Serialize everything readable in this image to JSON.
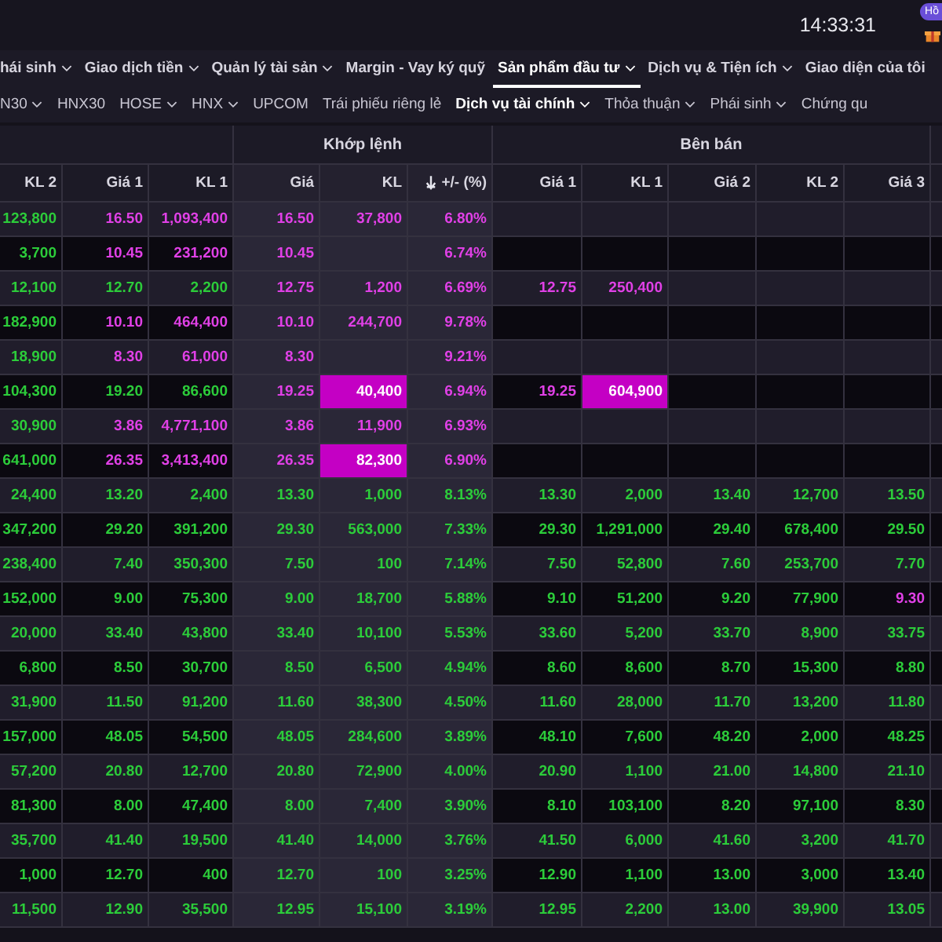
{
  "top_bar": {
    "time": "14:33:31",
    "badge": "Hồ"
  },
  "main_menu": [
    {
      "label": "hái sinh",
      "dropdown": true,
      "selected": false
    },
    {
      "label": "Giao dịch tiền",
      "dropdown": true,
      "selected": false
    },
    {
      "label": "Quản lý tài sản",
      "dropdown": true,
      "selected": false
    },
    {
      "label": "Margin - Vay ký quỹ",
      "dropdown": false,
      "selected": false
    },
    {
      "label": "Sản phẩm đầu tư",
      "dropdown": true,
      "selected": true
    },
    {
      "label": "Dịch vụ & Tiện ích",
      "dropdown": true,
      "selected": false
    },
    {
      "label": "Giao diện của tôi",
      "dropdown": false,
      "selected": false
    }
  ],
  "board_tabs": [
    {
      "label": "N30",
      "dropdown": true,
      "selected": false
    },
    {
      "label": "HNX30",
      "dropdown": false,
      "selected": false
    },
    {
      "label": "HOSE",
      "dropdown": true,
      "selected": false
    },
    {
      "label": "HNX",
      "dropdown": true,
      "selected": false
    },
    {
      "label": "UPCOM",
      "dropdown": false,
      "selected": false
    },
    {
      "label": "Trái phiếu riêng lẻ",
      "dropdown": false,
      "selected": false
    },
    {
      "label": "Dịch vụ tài chính",
      "dropdown": true,
      "selected": true
    },
    {
      "label": "Thỏa thuận",
      "dropdown": true,
      "selected": false
    },
    {
      "label": "Phái sinh",
      "dropdown": true,
      "selected": false
    },
    {
      "label": "Chứng qu",
      "dropdown": false,
      "selected": false
    }
  ],
  "table": {
    "groups": [
      "Khớp lệnh",
      "Bên bán"
    ],
    "columns": [
      {
        "label": "KL 2",
        "sorted": false
      },
      {
        "label": "Giá 1",
        "sorted": false
      },
      {
        "label": "KL 1",
        "sorted": false
      },
      {
        "label": "Giá",
        "sorted": false
      },
      {
        "label": "KL",
        "sorted": false
      },
      {
        "label": "+/- (%)",
        "sorted": true
      },
      {
        "label": "Giá 1",
        "sorted": false
      },
      {
        "label": "KL 1",
        "sorted": false
      },
      {
        "label": "Giá 2",
        "sorted": false
      },
      {
        "label": "KL 2",
        "sorted": false
      },
      {
        "label": "Giá 3",
        "sorted": false
      }
    ],
    "rows": [
      {
        "cells": [
          {
            "text": "123,800",
            "color": "#2ccc3a",
            "highlighted": false
          },
          {
            "text": "16.50",
            "color": "#e040e6",
            "highlighted": false
          },
          {
            "text": "1,093,400",
            "color": "#e040e6",
            "highlighted": false
          },
          {
            "text": "16.50",
            "color": "#e040e6",
            "highlighted": false
          },
          {
            "text": "37,800",
            "color": "#e040e6",
            "highlighted": false
          },
          {
            "text": "6.80%",
            "color": "#e040e6",
            "highlighted": false
          },
          {},
          {},
          {},
          {},
          {}
        ]
      },
      {
        "cells": [
          {
            "text": "3,700",
            "color": "#2ccc3a",
            "highlighted": false
          },
          {
            "text": "10.45",
            "color": "#e040e6",
            "highlighted": false
          },
          {
            "text": "231,200",
            "color": "#e040e6",
            "highlighted": false
          },
          {
            "text": "10.45",
            "color": "#e040e6",
            "highlighted": false
          },
          {},
          {
            "text": "6.74%",
            "color": "#e040e6",
            "highlighted": false
          },
          {},
          {},
          {},
          {},
          {}
        ]
      },
      {
        "cells": [
          {
            "text": "12,100",
            "color": "#2ccc3a",
            "highlighted": false
          },
          {
            "text": "12.70",
            "color": "#2ccc3a",
            "highlighted": false
          },
          {
            "text": "2,200",
            "color": "#2ccc3a",
            "highlighted": false
          },
          {
            "text": "12.75",
            "color": "#e040e6",
            "highlighted": false
          },
          {
            "text": "1,200",
            "color": "#e040e6",
            "highlighted": false
          },
          {
            "text": "6.69%",
            "color": "#e040e6",
            "highlighted": false
          },
          {
            "text": "12.75",
            "color": "#e040e6",
            "highlighted": false
          },
          {
            "text": "250,400",
            "color": "#e040e6",
            "highlighted": false
          },
          {},
          {},
          {}
        ]
      },
      {
        "cells": [
          {
            "text": "182,900",
            "color": "#2ccc3a",
            "highlighted": false
          },
          {
            "text": "10.10",
            "color": "#e040e6",
            "highlighted": false
          },
          {
            "text": "464,400",
            "color": "#e040e6",
            "highlighted": false
          },
          {
            "text": "10.10",
            "color": "#e040e6",
            "highlighted": false
          },
          {
            "text": "244,700",
            "color": "#e040e6",
            "highlighted": false
          },
          {
            "text": "9.78%",
            "color": "#e040e6",
            "highlighted": false
          },
          {},
          {},
          {},
          {},
          {}
        ]
      },
      {
        "cells": [
          {
            "text": "18,900",
            "color": "#2ccc3a",
            "highlighted": false
          },
          {
            "text": "8.30",
            "color": "#e040e6",
            "highlighted": false
          },
          {
            "text": "61,000",
            "color": "#e040e6",
            "highlighted": false
          },
          {
            "text": "8.30",
            "color": "#e040e6",
            "highlighted": false
          },
          {},
          {
            "text": "9.21%",
            "color": "#e040e6",
            "highlighted": false
          },
          {},
          {},
          {},
          {},
          {}
        ]
      },
      {
        "cells": [
          {
            "text": "104,300",
            "color": "#2ccc3a",
            "highlighted": false
          },
          {
            "text": "19.20",
            "color": "#2ccc3a",
            "highlighted": false
          },
          {
            "text": "86,600",
            "color": "#2ccc3a",
            "highlighted": false
          },
          {
            "text": "19.25",
            "color": "#e040e6",
            "highlighted": false
          },
          {
            "text": "40,400",
            "color": "#ffffff",
            "highlighted": true
          },
          {
            "text": "6.94%",
            "color": "#e040e6",
            "highlighted": false
          },
          {
            "text": "19.25",
            "color": "#e040e6",
            "highlighted": false
          },
          {
            "text": "604,900",
            "color": "#ffffff",
            "highlighted": true
          },
          {},
          {},
          {}
        ]
      },
      {
        "cells": [
          {
            "text": "30,900",
            "color": "#2ccc3a",
            "highlighted": false
          },
          {
            "text": "3.86",
            "color": "#e040e6",
            "highlighted": false
          },
          {
            "text": "4,771,100",
            "color": "#e040e6",
            "highlighted": false
          },
          {
            "text": "3.86",
            "color": "#e040e6",
            "highlighted": false
          },
          {
            "text": "11,900",
            "color": "#e040e6",
            "highlighted": false
          },
          {
            "text": "6.93%",
            "color": "#e040e6",
            "highlighted": false
          },
          {},
          {},
          {},
          {},
          {}
        ]
      },
      {
        "cells": [
          {
            "text": "641,000",
            "color": "#2ccc3a",
            "highlighted": false
          },
          {
            "text": "26.35",
            "color": "#e040e6",
            "highlighted": false
          },
          {
            "text": "3,413,400",
            "color": "#e040e6",
            "highlighted": false
          },
          {
            "text": "26.35",
            "color": "#e040e6",
            "highlighted": false
          },
          {
            "text": "82,300",
            "color": "#ffffff",
            "highlighted": true
          },
          {
            "text": "6.90%",
            "color": "#e040e6",
            "highlighted": false
          },
          {},
          {},
          {},
          {},
          {}
        ]
      },
      {
        "cells": [
          {
            "text": "24,400",
            "color": "#2ccc3a",
            "highlighted": false
          },
          {
            "text": "13.20",
            "color": "#2ccc3a",
            "highlighted": false
          },
          {
            "text": "2,400",
            "color": "#2ccc3a",
            "highlighted": false
          },
          {
            "text": "13.30",
            "color": "#2ccc3a",
            "highlighted": false
          },
          {
            "text": "1,000",
            "color": "#2ccc3a",
            "highlighted": false
          },
          {
            "text": "8.13%",
            "color": "#2ccc3a",
            "highlighted": false
          },
          {
            "text": "13.30",
            "color": "#2ccc3a",
            "highlighted": false
          },
          {
            "text": "2,000",
            "color": "#2ccc3a",
            "highlighted": false
          },
          {
            "text": "13.40",
            "color": "#2ccc3a",
            "highlighted": false
          },
          {
            "text": "12,700",
            "color": "#2ccc3a",
            "highlighted": false
          },
          {
            "text": "13.50",
            "color": "#2ccc3a",
            "highlighted": false
          }
        ]
      },
      {
        "cells": [
          {
            "text": "347,200",
            "color": "#2ccc3a",
            "highlighted": false
          },
          {
            "text": "29.20",
            "color": "#2ccc3a",
            "highlighted": false
          },
          {
            "text": "391,200",
            "color": "#2ccc3a",
            "highlighted": false
          },
          {
            "text": "29.30",
            "color": "#2ccc3a",
            "highlighted": false
          },
          {
            "text": "563,000",
            "color": "#2ccc3a",
            "highlighted": false
          },
          {
            "text": "7.33%",
            "color": "#2ccc3a",
            "highlighted": false
          },
          {
            "text": "29.30",
            "color": "#2ccc3a",
            "highlighted": false
          },
          {
            "text": "1,291,000",
            "color": "#2ccc3a",
            "highlighted": false
          },
          {
            "text": "29.40",
            "color": "#2ccc3a",
            "highlighted": false
          },
          {
            "text": "678,400",
            "color": "#2ccc3a",
            "highlighted": false
          },
          {
            "text": "29.50",
            "color": "#2ccc3a",
            "highlighted": false
          }
        ]
      },
      {
        "cells": [
          {
            "text": "238,400",
            "color": "#2ccc3a",
            "highlighted": false
          },
          {
            "text": "7.40",
            "color": "#2ccc3a",
            "highlighted": false
          },
          {
            "text": "350,300",
            "color": "#2ccc3a",
            "highlighted": false
          },
          {
            "text": "7.50",
            "color": "#2ccc3a",
            "highlighted": false
          },
          {
            "text": "100",
            "color": "#2ccc3a",
            "highlighted": false
          },
          {
            "text": "7.14%",
            "color": "#2ccc3a",
            "highlighted": false
          },
          {
            "text": "7.50",
            "color": "#2ccc3a",
            "highlighted": false
          },
          {
            "text": "52,800",
            "color": "#2ccc3a",
            "highlighted": false
          },
          {
            "text": "7.60",
            "color": "#2ccc3a",
            "highlighted": false
          },
          {
            "text": "253,700",
            "color": "#2ccc3a",
            "highlighted": false
          },
          {
            "text": "7.70",
            "color": "#2ccc3a",
            "highlighted": false
          }
        ]
      },
      {
        "cells": [
          {
            "text": "152,000",
            "color": "#2ccc3a",
            "highlighted": false
          },
          {
            "text": "9.00",
            "color": "#2ccc3a",
            "highlighted": false
          },
          {
            "text": "75,300",
            "color": "#2ccc3a",
            "highlighted": false
          },
          {
            "text": "9.00",
            "color": "#2ccc3a",
            "highlighted": false
          },
          {
            "text": "18,700",
            "color": "#2ccc3a",
            "highlighted": false
          },
          {
            "text": "5.88%",
            "color": "#2ccc3a",
            "highlighted": false
          },
          {
            "text": "9.10",
            "color": "#2ccc3a",
            "highlighted": false
          },
          {
            "text": "51,200",
            "color": "#2ccc3a",
            "highlighted": false
          },
          {
            "text": "9.20",
            "color": "#2ccc3a",
            "highlighted": false
          },
          {
            "text": "77,900",
            "color": "#2ccc3a",
            "highlighted": false
          },
          {
            "text": "9.30",
            "color": "#e040e6",
            "highlighted": false
          }
        ]
      },
      {
        "cells": [
          {
            "text": "20,000",
            "color": "#2ccc3a",
            "highlighted": false
          },
          {
            "text": "33.40",
            "color": "#2ccc3a",
            "highlighted": false
          },
          {
            "text": "43,800",
            "color": "#2ccc3a",
            "highlighted": false
          },
          {
            "text": "33.40",
            "color": "#2ccc3a",
            "highlighted": false
          },
          {
            "text": "10,100",
            "color": "#2ccc3a",
            "highlighted": false
          },
          {
            "text": "5.53%",
            "color": "#2ccc3a",
            "highlighted": false
          },
          {
            "text": "33.60",
            "color": "#2ccc3a",
            "highlighted": false
          },
          {
            "text": "5,200",
            "color": "#2ccc3a",
            "highlighted": false
          },
          {
            "text": "33.70",
            "color": "#2ccc3a",
            "highlighted": false
          },
          {
            "text": "8,900",
            "color": "#2ccc3a",
            "highlighted": false
          },
          {
            "text": "33.75",
            "color": "#2ccc3a",
            "highlighted": false
          }
        ]
      },
      {
        "cells": [
          {
            "text": "6,800",
            "color": "#2ccc3a",
            "highlighted": false
          },
          {
            "text": "8.50",
            "color": "#2ccc3a",
            "highlighted": false
          },
          {
            "text": "30,700",
            "color": "#2ccc3a",
            "highlighted": false
          },
          {
            "text": "8.50",
            "color": "#2ccc3a",
            "highlighted": false
          },
          {
            "text": "6,500",
            "color": "#2ccc3a",
            "highlighted": false
          },
          {
            "text": "4.94%",
            "color": "#2ccc3a",
            "highlighted": false
          },
          {
            "text": "8.60",
            "color": "#2ccc3a",
            "highlighted": false
          },
          {
            "text": "8,600",
            "color": "#2ccc3a",
            "highlighted": false
          },
          {
            "text": "8.70",
            "color": "#2ccc3a",
            "highlighted": false
          },
          {
            "text": "15,300",
            "color": "#2ccc3a",
            "highlighted": false
          },
          {
            "text": "8.80",
            "color": "#2ccc3a",
            "highlighted": false
          }
        ]
      },
      {
        "cells": [
          {
            "text": "31,900",
            "color": "#2ccc3a",
            "highlighted": false
          },
          {
            "text": "11.50",
            "color": "#2ccc3a",
            "highlighted": false
          },
          {
            "text": "91,200",
            "color": "#2ccc3a",
            "highlighted": false
          },
          {
            "text": "11.60",
            "color": "#2ccc3a",
            "highlighted": false
          },
          {
            "text": "38,300",
            "color": "#2ccc3a",
            "highlighted": false
          },
          {
            "text": "4.50%",
            "color": "#2ccc3a",
            "highlighted": false
          },
          {
            "text": "11.60",
            "color": "#2ccc3a",
            "highlighted": false
          },
          {
            "text": "28,000",
            "color": "#2ccc3a",
            "highlighted": false
          },
          {
            "text": "11.70",
            "color": "#2ccc3a",
            "highlighted": false
          },
          {
            "text": "13,200",
            "color": "#2ccc3a",
            "highlighted": false
          },
          {
            "text": "11.80",
            "color": "#2ccc3a",
            "highlighted": false
          }
        ]
      },
      {
        "cells": [
          {
            "text": "157,000",
            "color": "#2ccc3a",
            "highlighted": false
          },
          {
            "text": "48.05",
            "color": "#2ccc3a",
            "highlighted": false
          },
          {
            "text": "54,500",
            "color": "#2ccc3a",
            "highlighted": false
          },
          {
            "text": "48.05",
            "color": "#2ccc3a",
            "highlighted": false
          },
          {
            "text": "284,600",
            "color": "#2ccc3a",
            "highlighted": false
          },
          {
            "text": "3.89%",
            "color": "#2ccc3a",
            "highlighted": false
          },
          {
            "text": "48.10",
            "color": "#2ccc3a",
            "highlighted": false
          },
          {
            "text": "7,600",
            "color": "#2ccc3a",
            "highlighted": false
          },
          {
            "text": "48.20",
            "color": "#2ccc3a",
            "highlighted": false
          },
          {
            "text": "2,000",
            "color": "#2ccc3a",
            "highlighted": false
          },
          {
            "text": "48.25",
            "color": "#2ccc3a",
            "highlighted": false
          }
        ]
      },
      {
        "cells": [
          {
            "text": "57,200",
            "color": "#2ccc3a",
            "highlighted": false
          },
          {
            "text": "20.80",
            "color": "#2ccc3a",
            "highlighted": false
          },
          {
            "text": "12,700",
            "color": "#2ccc3a",
            "highlighted": false
          },
          {
            "text": "20.80",
            "color": "#2ccc3a",
            "highlighted": false
          },
          {
            "text": "72,900",
            "color": "#2ccc3a",
            "highlighted": false
          },
          {
            "text": "4.00%",
            "color": "#2ccc3a",
            "highlighted": false
          },
          {
            "text": "20.90",
            "color": "#2ccc3a",
            "highlighted": false
          },
          {
            "text": "1,100",
            "color": "#2ccc3a",
            "highlighted": false
          },
          {
            "text": "21.00",
            "color": "#2ccc3a",
            "highlighted": false
          },
          {
            "text": "14,800",
            "color": "#2ccc3a",
            "highlighted": false
          },
          {
            "text": "21.10",
            "color": "#2ccc3a",
            "highlighted": false
          }
        ]
      },
      {
        "cells": [
          {
            "text": "81,300",
            "color": "#2ccc3a",
            "highlighted": false
          },
          {
            "text": "8.00",
            "color": "#2ccc3a",
            "highlighted": false
          },
          {
            "text": "47,400",
            "color": "#2ccc3a",
            "highlighted": false
          },
          {
            "text": "8.00",
            "color": "#2ccc3a",
            "highlighted": false
          },
          {
            "text": "7,400",
            "color": "#2ccc3a",
            "highlighted": false
          },
          {
            "text": "3.90%",
            "color": "#2ccc3a",
            "highlighted": false
          },
          {
            "text": "8.10",
            "color": "#2ccc3a",
            "highlighted": false
          },
          {
            "text": "103,100",
            "color": "#2ccc3a",
            "highlighted": false
          },
          {
            "text": "8.20",
            "color": "#2ccc3a",
            "highlighted": false
          },
          {
            "text": "97,100",
            "color": "#2ccc3a",
            "highlighted": false
          },
          {
            "text": "8.30",
            "color": "#2ccc3a",
            "highlighted": false
          }
        ]
      },
      {
        "cells": [
          {
            "text": "35,700",
            "color": "#2ccc3a",
            "highlighted": false
          },
          {
            "text": "41.40",
            "color": "#2ccc3a",
            "highlighted": false
          },
          {
            "text": "19,500",
            "color": "#2ccc3a",
            "highlighted": false
          },
          {
            "text": "41.40",
            "color": "#2ccc3a",
            "highlighted": false
          },
          {
            "text": "14,000",
            "color": "#2ccc3a",
            "highlighted": false
          },
          {
            "text": "3.76%",
            "color": "#2ccc3a",
            "highlighted": false
          },
          {
            "text": "41.50",
            "color": "#2ccc3a",
            "highlighted": false
          },
          {
            "text": "6,000",
            "color": "#2ccc3a",
            "highlighted": false
          },
          {
            "text": "41.60",
            "color": "#2ccc3a",
            "highlighted": false
          },
          {
            "text": "3,200",
            "color": "#2ccc3a",
            "highlighted": false
          },
          {
            "text": "41.70",
            "color": "#2ccc3a",
            "highlighted": false
          }
        ]
      },
      {
        "cells": [
          {
            "text": "1,000",
            "color": "#2ccc3a",
            "highlighted": false
          },
          {
            "text": "12.70",
            "color": "#2ccc3a",
            "highlighted": false
          },
          {
            "text": "400",
            "color": "#2ccc3a",
            "highlighted": false
          },
          {
            "text": "12.70",
            "color": "#2ccc3a",
            "highlighted": false
          },
          {
            "text": "100",
            "color": "#2ccc3a",
            "highlighted": false
          },
          {
            "text": "3.25%",
            "color": "#2ccc3a",
            "highlighted": false
          },
          {
            "text": "12.90",
            "color": "#2ccc3a",
            "highlighted": false
          },
          {
            "text": "1,100",
            "color": "#2ccc3a",
            "highlighted": false
          },
          {
            "text": "13.00",
            "color": "#2ccc3a",
            "highlighted": false
          },
          {
            "text": "3,000",
            "color": "#2ccc3a",
            "highlighted": false
          },
          {
            "text": "13.40",
            "color": "#2ccc3a",
            "highlighted": false
          }
        ]
      },
      {
        "cells": [
          {
            "text": "11,500",
            "color": "#2ccc3a",
            "highlighted": false
          },
          {
            "text": "12.90",
            "color": "#2ccc3a",
            "highlighted": false
          },
          {
            "text": "35,500",
            "color": "#2ccc3a",
            "highlighted": false
          },
          {
            "text": "12.95",
            "color": "#2ccc3a",
            "highlighted": false
          },
          {
            "text": "15,100",
            "color": "#2ccc3a",
            "highlighted": false
          },
          {
            "text": "3.19%",
            "color": "#2ccc3a",
            "highlighted": false
          },
          {
            "text": "12.95",
            "color": "#2ccc3a",
            "highlighted": false
          },
          {
            "text": "2,200",
            "color": "#2ccc3a",
            "highlighted": false
          },
          {
            "text": "13.00",
            "color": "#2ccc3a",
            "highlighted": false
          },
          {
            "text": "39,900",
            "color": "#2ccc3a",
            "highlighted": false
          },
          {
            "text": "13.05",
            "color": "#2ccc3a",
            "highlighted": false
          }
        ]
      }
    ]
  }
}
